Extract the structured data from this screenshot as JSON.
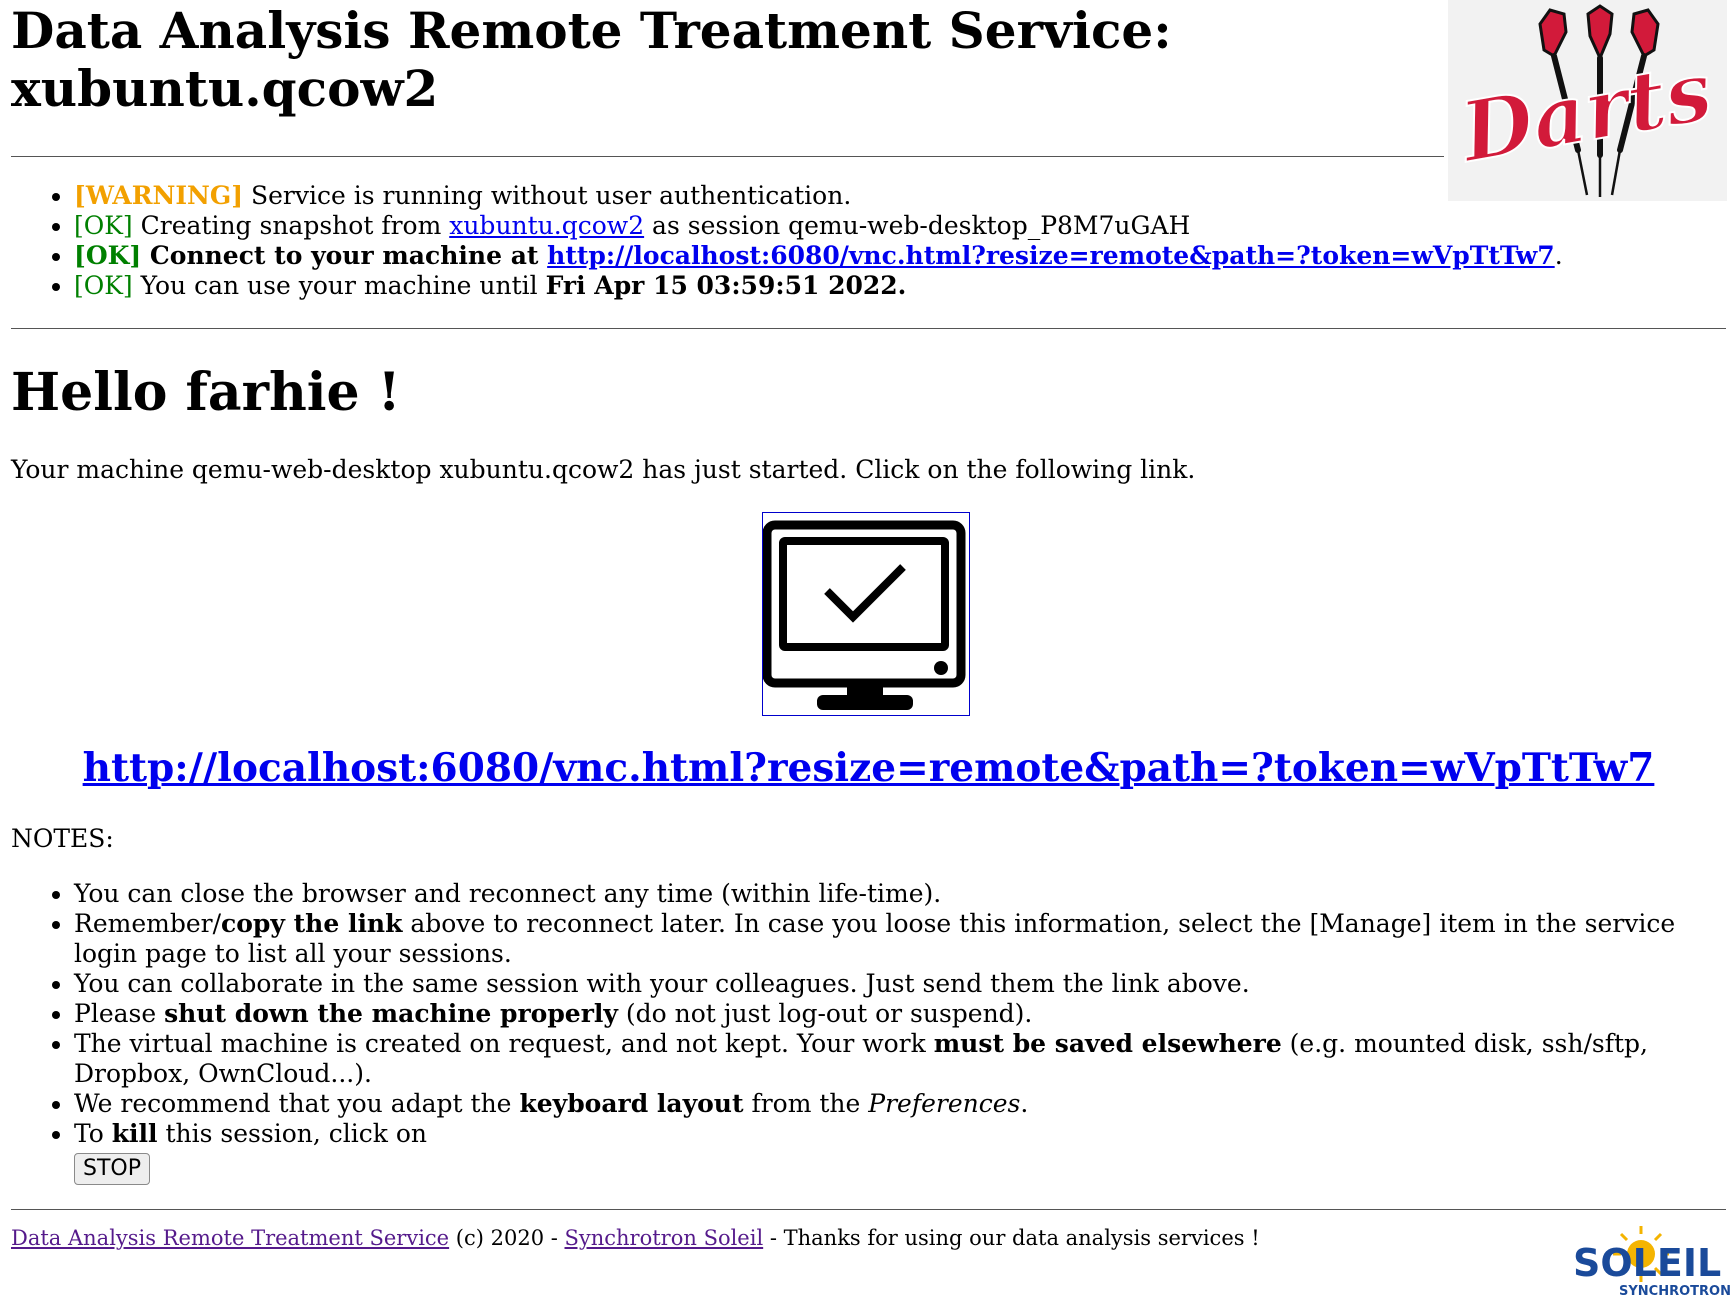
{
  "header": {
    "title": "Data Analysis Remote Treatment Service: xubuntu.qcow2",
    "logo_text": "Darts"
  },
  "status": {
    "warning_tag": "[WARNING]",
    "warning_text": " Service is running without user authentication.",
    "ok_tag": "[OK]",
    "snapshot_pre": " Creating snapshot from ",
    "snapshot_link": "xubuntu.qcow2",
    "snapshot_post": " as session qemu-web-desktop_P8M7uGAH",
    "connect_text": " Connect to your machine at ",
    "connect_link": "http://localhost:6080/vnc.html?resize=remote&path=?token=wVpTtTw7",
    "connect_post": ".",
    "until_text": " You can use your machine until ",
    "until_date": "Fri Apr 15 03:59:51 2022."
  },
  "main": {
    "greeting": "Hello farhie !",
    "intro": "Your machine qemu-web-desktop xubuntu.qcow2 has just started. Click on the following link.",
    "vnc_link": "http://localhost:6080/vnc.html?resize=remote&path=?token=wVpTtTw7"
  },
  "notes": {
    "label": "NOTES:",
    "n1": "You can close the browser and reconnect any time (within life-time).",
    "n2_pre": "Remember/",
    "n2_bold": "copy the link",
    "n2_post": " above to reconnect later. In case you loose this information, select the [Manage] item in the service login page to list all your sessions.",
    "n3": "You can collaborate in the same session with your colleagues. Just send them the link above.",
    "n4_pre": "Please ",
    "n4_bold": "shut down the machine properly",
    "n4_post": " (do not just log-out or suspend).",
    "n5_pre": "The virtual machine is created on request, and not kept. Your work ",
    "n5_bold": "must be saved elsewhere",
    "n5_post": " (e.g. mounted disk, ssh/sftp, Dropbox, OwnCloud...).",
    "n6_pre": "We recommend that you adapt the ",
    "n6_bold": "keyboard layout",
    "n6_mid": " from the ",
    "n6_ital": "Preferences",
    "n6_post": ".",
    "n7_pre": "To ",
    "n7_bold": "kill",
    "n7_post": " this session, click on",
    "stop_label": "STOP"
  },
  "footer": {
    "service_link": "Data Analysis Remote Treatment Service",
    "copyright": " (c) 2020 - ",
    "soleil_link": "Synchrotron Soleil",
    "thanks": " - Thanks for using our data analysis services !",
    "logo_main": "SOLEIL",
    "logo_sub": "SYNCHROTRON"
  },
  "colors": {
    "warning": "#f2a000",
    "ok": "#008000",
    "link": "#0000ee",
    "visited": "#551a8b",
    "darts_red": "#d21a3a",
    "soleil_blue": "#1a4a9a",
    "soleil_sun": "#f4b400"
  }
}
